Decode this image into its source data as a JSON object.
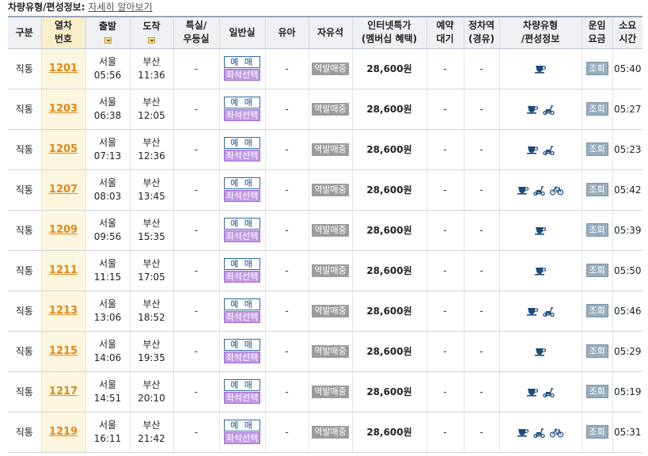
{
  "top": {
    "label": "차량유형/편성정보:",
    "link": "자세히 알아보기"
  },
  "headers": {
    "type": "구분",
    "trainno_1": "열차",
    "trainno_2": "번호",
    "dep": "출발",
    "arr": "도착",
    "special_1": "특실/",
    "special_2": "우등실",
    "general": "일반실",
    "infant": "유아",
    "standing": "자유석",
    "netprice_1": "인터넷특가",
    "netprice_2": "(멤버십 혜택)",
    "waitlist_1": "예약",
    "waitlist_2": "대기",
    "stops_1": "정차역",
    "stops_2": "(경유)",
    "vehicle_1": "차량유형",
    "vehicle_2": "/편성정보",
    "fare_1": "운임",
    "fare_2": "요금",
    "duration_1": "소요",
    "duration_2": "시간"
  },
  "labels": {
    "reserve": "예 매",
    "seat_select": "좌석선택",
    "station_sale": "역발매중",
    "fare_view": "조회",
    "dash": "-"
  },
  "rows": [
    {
      "kind": "직통",
      "train_no": "1201",
      "dep_station": "서울",
      "dep_time": "05:56",
      "arr_station": "부산",
      "arr_time": "11:36",
      "price": "28,600원",
      "duration": "05:40",
      "icons": [
        "cafe-icon"
      ]
    },
    {
      "kind": "직통",
      "train_no": "1203",
      "dep_station": "서울",
      "dep_time": "06:38",
      "arr_station": "부산",
      "arr_time": "12:05",
      "price": "28,600원",
      "duration": "05:27",
      "icons": [
        "cafe-icon",
        "scooter-icon"
      ]
    },
    {
      "kind": "직통",
      "train_no": "1205",
      "dep_station": "서울",
      "dep_time": "07:13",
      "arr_station": "부산",
      "arr_time": "12:36",
      "price": "28,600원",
      "duration": "05:23",
      "icons": [
        "cafe-icon",
        "scooter-icon"
      ]
    },
    {
      "kind": "직통",
      "train_no": "1207",
      "dep_station": "서울",
      "dep_time": "08:03",
      "arr_station": "부산",
      "arr_time": "13:45",
      "price": "28,600원",
      "duration": "05:42",
      "icons": [
        "cafe-icon",
        "scooter-icon",
        "bicycle-icon"
      ]
    },
    {
      "kind": "직통",
      "train_no": "1209",
      "dep_station": "서울",
      "dep_time": "09:56",
      "arr_station": "부산",
      "arr_time": "15:35",
      "price": "28,600원",
      "duration": "05:39",
      "icons": [
        "cafe-icon"
      ]
    },
    {
      "kind": "직통",
      "train_no": "1211",
      "dep_station": "서울",
      "dep_time": "11:15",
      "arr_station": "부산",
      "arr_time": "17:05",
      "price": "28,600원",
      "duration": "05:50",
      "icons": [
        "cafe-icon"
      ]
    },
    {
      "kind": "직통",
      "train_no": "1213",
      "dep_station": "서울",
      "dep_time": "13:06",
      "arr_station": "부산",
      "arr_time": "18:52",
      "price": "28,600원",
      "duration": "05:46",
      "icons": [
        "cafe-icon",
        "scooter-icon"
      ]
    },
    {
      "kind": "직통",
      "train_no": "1215",
      "dep_station": "서울",
      "dep_time": "14:06",
      "arr_station": "부산",
      "arr_time": "19:35",
      "price": "28,600원",
      "duration": "05:29",
      "icons": [
        "cafe-icon"
      ]
    },
    {
      "kind": "직통",
      "train_no": "1217",
      "dep_station": "서울",
      "dep_time": "14:51",
      "arr_station": "부산",
      "arr_time": "20:10",
      "price": "28,600원",
      "duration": "05:19",
      "icons": [
        "cafe-icon",
        "scooter-icon"
      ]
    },
    {
      "kind": "직통",
      "train_no": "1219",
      "dep_station": "서울",
      "dep_time": "16:11",
      "arr_station": "부산",
      "arr_time": "21:42",
      "price": "28,600원",
      "duration": "05:31",
      "icons": [
        "cafe-icon",
        "scooter-icon",
        "bicycle-icon"
      ]
    }
  ],
  "colors": {
    "train_link": "#e1871a",
    "icon": "#1b4a78",
    "seat_button": "#c49be6",
    "station_button": "#9c9c9c",
    "fare_button": "#98aebd"
  }
}
